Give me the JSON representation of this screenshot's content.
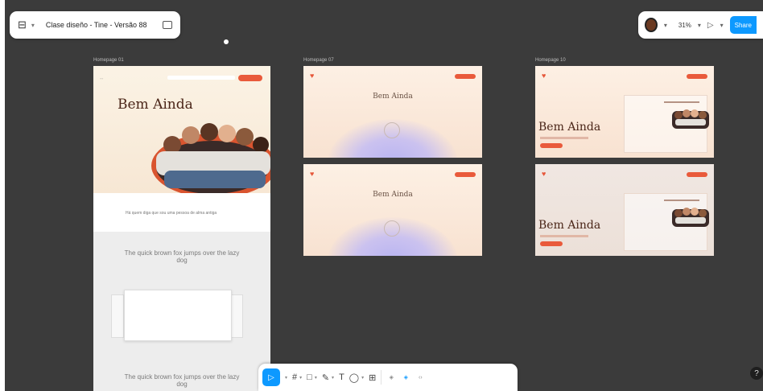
{
  "file": {
    "menu_icon": "figma-menu-icon",
    "name": "Clase diseño - Tine - Versão 88"
  },
  "topbar_right": {
    "avatar_icon": "user-avatar-icon",
    "zoom": "31%",
    "play_icon": "present-play-icon",
    "share_label": "Share"
  },
  "frames": {
    "labels": [
      "Homepage 01",
      "Homepage 07",
      "Homepage 10"
    ],
    "brand_title": "Bem Ainda"
  },
  "mobile": {
    "white_text": "Há quem diga que sou uma pessoa de alma antiga",
    "paragraph_1": "The quick brown fox jumps over the lazy dog",
    "paragraph_2": "The quick brown fox jumps over the lazy dog"
  },
  "colors": {
    "canvas": "#3b3b3b",
    "accent": "#0d99ff",
    "brand": "#e95a3b"
  },
  "toolbar": {
    "tools": [
      {
        "name": "move-tool-icon",
        "glyph": "▷"
      },
      {
        "name": "frame-tool-icon",
        "glyph": "#"
      },
      {
        "name": "rectangle-tool-icon",
        "glyph": "□"
      },
      {
        "name": "pen-tool-icon",
        "glyph": "✎"
      },
      {
        "name": "text-tool-icon",
        "glyph": "T"
      },
      {
        "name": "comment-tool-icon",
        "glyph": "◯"
      },
      {
        "name": "actions-tool-icon",
        "glyph": "⊞"
      }
    ]
  },
  "help_label": "?"
}
